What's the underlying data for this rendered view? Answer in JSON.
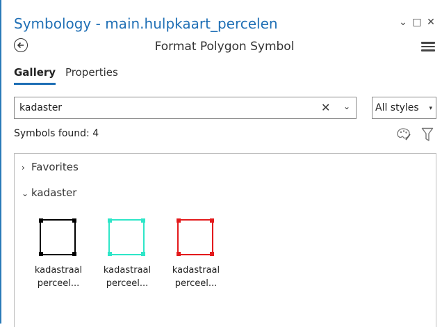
{
  "window": {
    "title": "Symbology - main.hulpkaart_percelen",
    "controls": {
      "options": "⌄",
      "maximize": "□",
      "close": "✕"
    }
  },
  "header": {
    "subtitle": "Format Polygon Symbol",
    "back_icon": "back-arrow-circle-icon",
    "menu_icon": "hamburger-menu-icon"
  },
  "tabs": [
    {
      "label": "Gallery",
      "active": true
    },
    {
      "label": "Properties",
      "active": false
    }
  ],
  "search": {
    "value": "kadaster",
    "clear_glyph": "✕",
    "dropdown_glyph": "⌄"
  },
  "styles_dropdown": {
    "selected": "All styles",
    "caret": "▾"
  },
  "results": {
    "found_label": "Symbols found: 4"
  },
  "gallery": {
    "groups": [
      {
        "label": "Favorites",
        "expanded": false,
        "chevron": "›"
      },
      {
        "label": "kadaster",
        "expanded": true,
        "chevron": "⌄"
      }
    ],
    "symbols": [
      {
        "line1": "kadastraal",
        "line2": "perceel...",
        "outline_color": "#000000",
        "corner_color": "#000000"
      },
      {
        "line1": "kadastraal",
        "line2": "perceel...",
        "outline_color": "#2ee6c8",
        "corner_color": "#2ee6c8"
      },
      {
        "line1": "kadastraal",
        "line2": "perceel...",
        "outline_color": "#e31a1c",
        "corner_color": "#e31a1c"
      }
    ]
  },
  "colors": {
    "accent": "#1f6fb5"
  }
}
